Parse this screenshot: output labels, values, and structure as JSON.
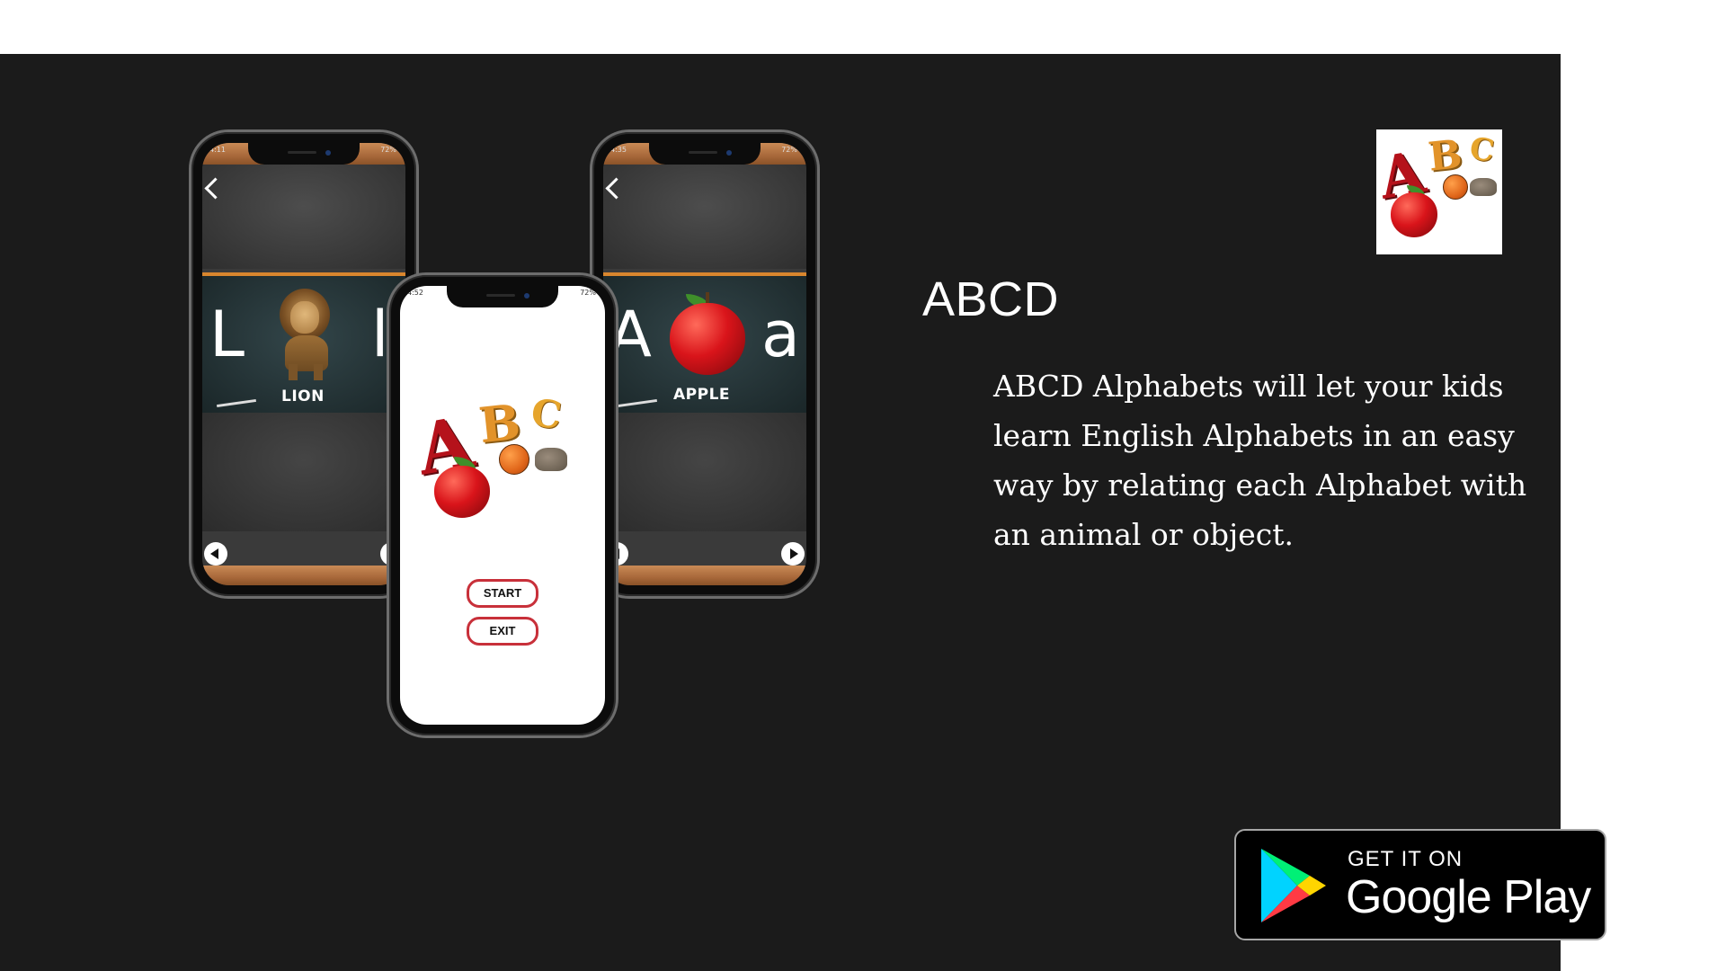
{
  "app": {
    "title": "ABCD",
    "description": "ABCD Alphabets will let your kids learn English Alphabets in an easy way by relating each Alphabet with an animal or object."
  },
  "logo": {
    "letter_a": "A",
    "letter_b": "B",
    "letter_c": "C"
  },
  "phones": {
    "left": {
      "time": "4:11",
      "battery": "72%",
      "upper_letter": "L",
      "lower_letter": "l",
      "word": "LION"
    },
    "center": {
      "time": "4:52",
      "battery": "72%",
      "start_label": "START",
      "exit_label": "EXIT"
    },
    "right": {
      "time": "4:35",
      "battery": "72%",
      "upper_letter": "A",
      "lower_letter": "a",
      "word": "APPLE"
    }
  },
  "store_badge": {
    "line1": "GET IT ON",
    "line2": "Google Play"
  },
  "colors": {
    "panel_bg": "#1b1b1b",
    "accent_red": "#b5121b",
    "accent_orange": "#e2932a",
    "button_border": "#c8303a"
  }
}
